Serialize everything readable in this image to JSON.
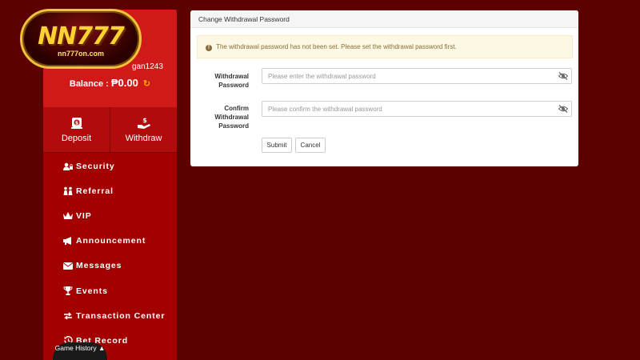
{
  "logo": {
    "brand": "NN777",
    "site": "nn777on.com"
  },
  "account": {
    "username": "gan1243",
    "balance_label": "Balance :",
    "balance_value": "₱0.00"
  },
  "actions": {
    "deposit": "Deposit",
    "withdraw": "Withdraw"
  },
  "menu": [
    {
      "label": "Security",
      "icon": "user-lock-icon"
    },
    {
      "label": "Referral",
      "icon": "people-icon"
    },
    {
      "label": "VIP",
      "icon": "crown-icon"
    },
    {
      "label": "Announcement",
      "icon": "megaphone-icon"
    },
    {
      "label": "Messages",
      "icon": "envelope-icon"
    },
    {
      "label": "Events",
      "icon": "trophy-icon"
    },
    {
      "label": "Transaction Center",
      "icon": "exchange-icon"
    },
    {
      "label": "Bet Record",
      "icon": "history-icon"
    }
  ],
  "game_history": "Game History",
  "panel": {
    "title": "Change Withdrawal Password",
    "alert": "The withdrawal password has not been set. Please set the withdrawal password first.",
    "fields": {
      "password_label_1": "Withdrawal",
      "password_label_2": "Password",
      "password_placeholder": "Please enter the withdrawal password",
      "confirm_label_1": "Confirm",
      "confirm_label_2": "Withdrawal",
      "confirm_label_3": "Password",
      "confirm_placeholder": "Please confirm the withdrawal password"
    },
    "submit": "Submit",
    "cancel": "Cancel"
  },
  "colors": {
    "background": "#5c0000",
    "sidebar": "#a30000",
    "sidebar_top": "#d01a1a",
    "accent_gold": "#ffd233"
  }
}
